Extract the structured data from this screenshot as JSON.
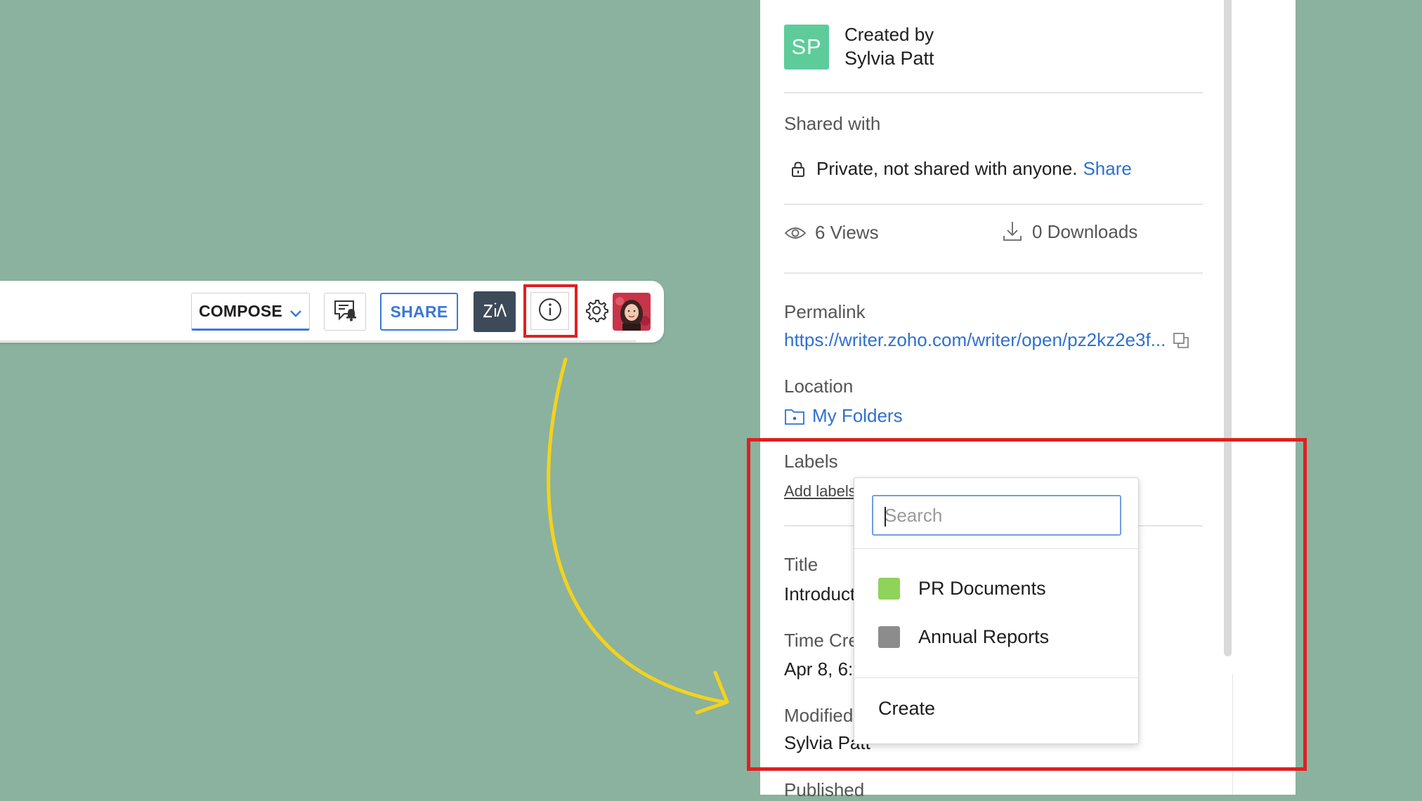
{
  "toolbar": {
    "compose_label": "COMPOSE",
    "share_label": "SHARE",
    "icons": [
      "notification-comment-icon",
      "zia-icon",
      "info-icon",
      "gear-icon",
      "user-avatar"
    ]
  },
  "panel": {
    "creator": {
      "initials": "SP",
      "created_by_label": "Created by",
      "name": "Sylvia Patt"
    },
    "shared_with": {
      "heading": "Shared with",
      "status": "Private, not shared with anyone.",
      "share_link": "Share"
    },
    "stats": {
      "views": "6 Views",
      "downloads": "0 Downloads"
    },
    "permalink": {
      "heading": "Permalink",
      "url": "https://writer.zoho.com/writer/open/pz2kz2e3f..."
    },
    "location": {
      "heading": "Location",
      "folder": "My Folders"
    },
    "labels": {
      "heading": "Labels",
      "add_link": "Add labels"
    },
    "title": {
      "heading": "Title",
      "value": "Introduct"
    },
    "time_created": {
      "heading": "Time Cre",
      "value": "Apr 8, 6:("
    },
    "modified": {
      "heading": "Modified",
      "value": "Sylvia Patt"
    },
    "published": {
      "heading": "Published"
    }
  },
  "dropdown": {
    "search_placeholder": "Search",
    "items": [
      {
        "name": "PR Documents",
        "color": "#8fd35a"
      },
      {
        "name": "Annual Reports",
        "color": "#8c8c8c"
      }
    ],
    "create_label": "Create"
  },
  "colors": {
    "background": "#8ab29f",
    "accent_blue": "#3a78d8",
    "highlight_red": "#e02020",
    "arrow_yellow": "#f5d21a",
    "avatar_green": "#5dcc9a"
  }
}
